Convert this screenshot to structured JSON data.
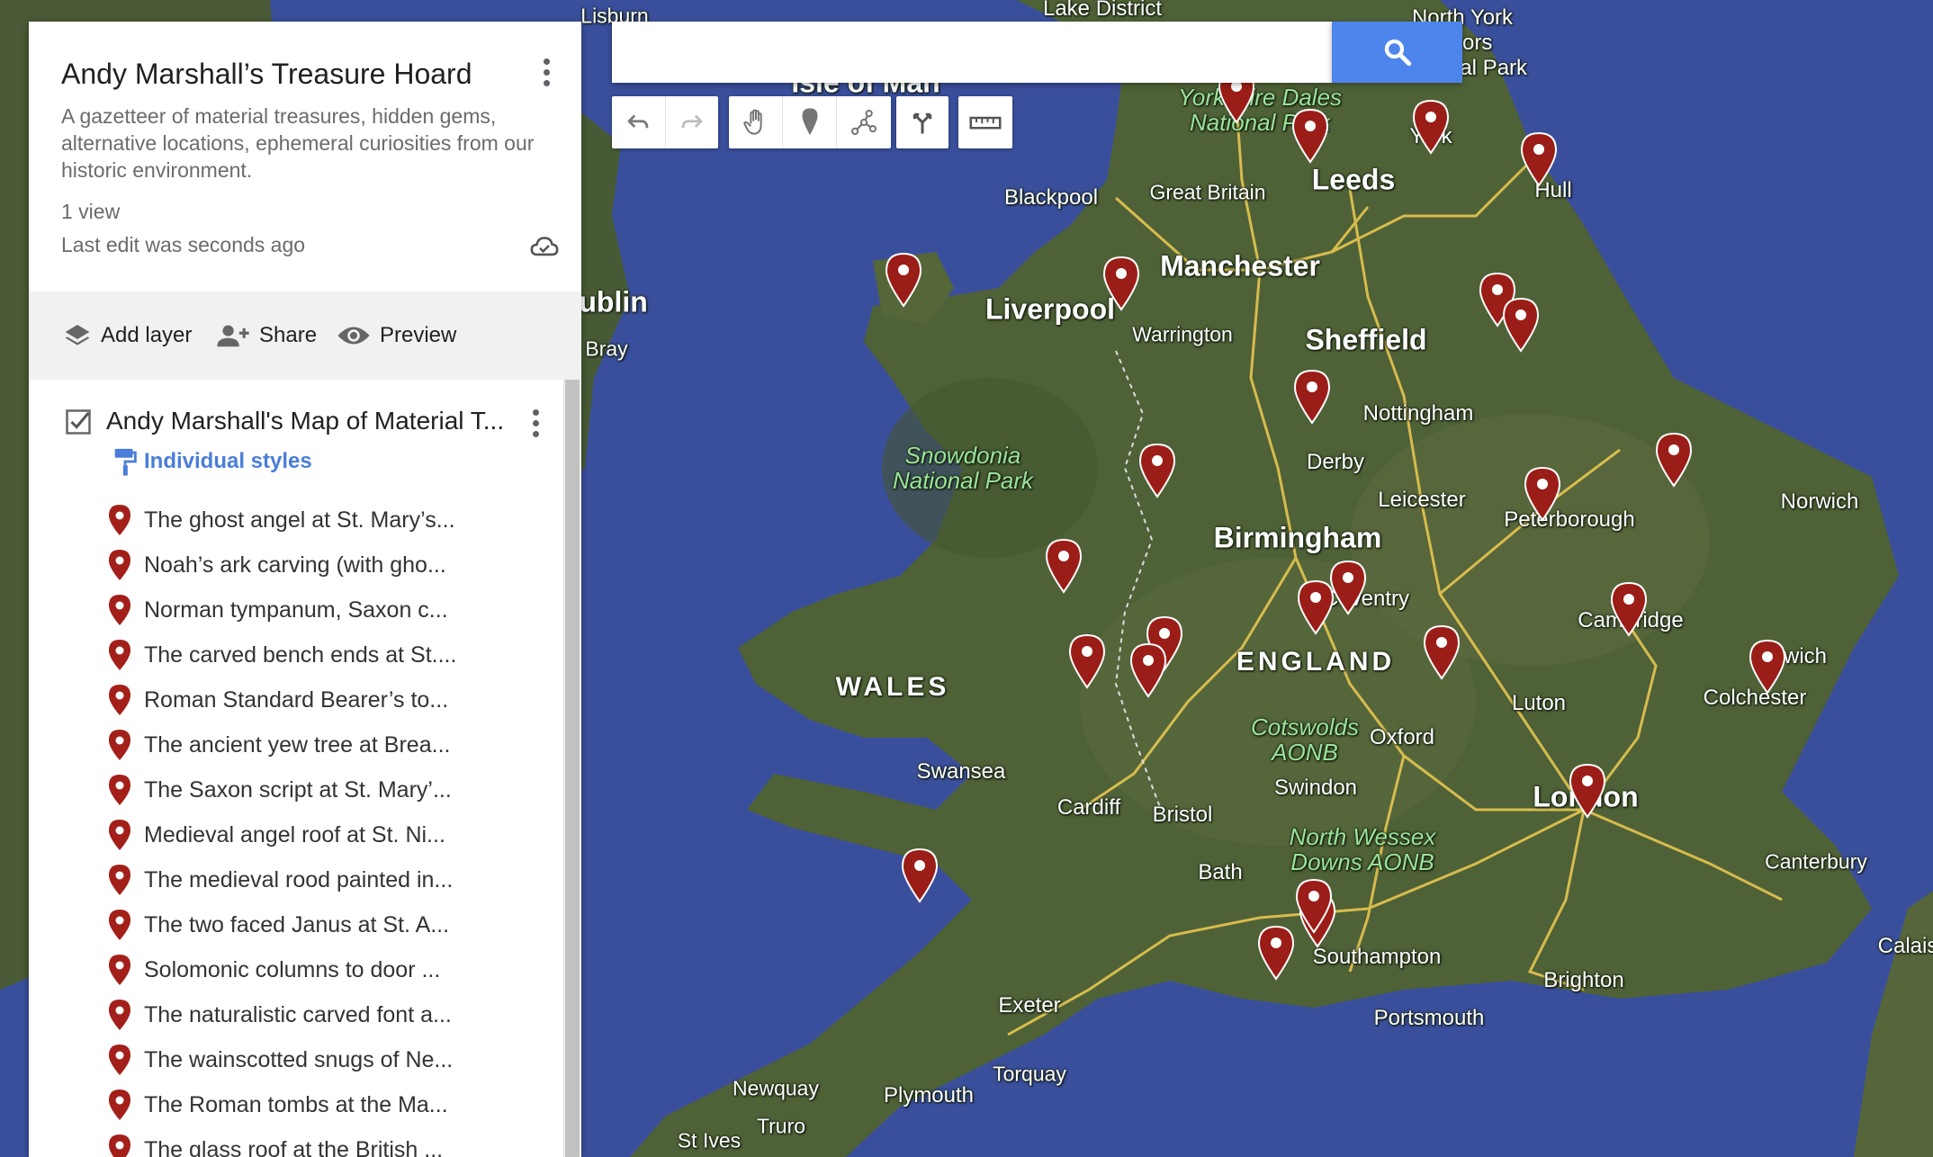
{
  "colors": {
    "sea": "#3a4f9c",
    "land": "#4f6137",
    "road": "#e6c650",
    "pin": "#9b1d17",
    "accent": "#4d85ec"
  },
  "panel": {
    "title": "Andy Marshall’s Treasure Hoard",
    "description": "A gazetteer of material treasures, hidden gems, alternative locations, ephemeral curiosities from our historic environment.",
    "views": "1 view",
    "last_edit": "Last edit was seconds ago",
    "actions": {
      "add_layer": "Add layer",
      "share": "Share",
      "preview": "Preview"
    }
  },
  "layer": {
    "name": "Andy Marshall's Map of Material T...",
    "checked": true,
    "style_label": "Individual styles",
    "features": [
      "The ghost angel at St. Mary’s...",
      "Noah’s ark carving (with gho...",
      "Norman tympanum, Saxon c...",
      "The carved bench ends at St....",
      "Roman Standard Bearer’s to...",
      "The ancient yew tree at Brea...",
      "The  Saxon script at St. Mary’...",
      "Medieval angel roof at St. Ni...",
      "The medieval rood painted in...",
      "The two faced Janus at St. A...",
      "Solomonic columns to door ...",
      "The naturalistic carved font a...",
      "The wainscotted snugs of Ne...",
      "The Roman tombs at the Ma...",
      "The glass roof at the British ..."
    ]
  },
  "search": {
    "value": "",
    "placeholder": ""
  },
  "toolbar": [
    "undo-icon",
    "redo-icon",
    "hand-icon",
    "marker-icon",
    "draw-line-icon",
    "directions-icon",
    "ruler-icon"
  ],
  "map_labels": {
    "lisburn": "Lisburn",
    "lake_district": "Lake District",
    "north_york_moors": "North York\nMoors\nNational Park",
    "isle_of_man": "Isle of Man",
    "dales": "Yorkshire Dales\nNational Park",
    "leeds": "Leeds",
    "york": "York",
    "hull": "Hull",
    "blackpool": "Blackpool",
    "great_britain": "Great Britain",
    "manchester": "Manchester",
    "liverpool": "Liverpool",
    "warrington": "Warrington",
    "sheffield": "Sheffield",
    "dublin": "Dublin",
    "bray": "Bray",
    "nottingham": "Nottingham",
    "derby": "Derby",
    "snowdonia": "Snowdonia\nNational Park",
    "leicester": "Leicester",
    "peterborough": "Peterborough",
    "norwich": "Norwich",
    "birmingham": "Birmingham",
    "coventry": "Coventry",
    "cambridge": "Cambridge",
    "england": "ENGLAND",
    "wales": "WALES",
    "ipswich": "Ipswich",
    "colchester": "Colchester",
    "luton": "Luton",
    "cotswolds": "Cotswolds\nAONB",
    "oxford": "Oxford",
    "swansea": "Swansea",
    "swindon": "Swindon",
    "london": "London",
    "cardiff": "Cardiff",
    "bristol": "Bristol",
    "north_wessex": "North Wessex\nDowns AONB",
    "bath": "Bath",
    "canterbury": "Canterbury",
    "southampton": "Southampton",
    "calais": "Calais",
    "exeter": "Exeter",
    "brighton": "Brighton",
    "portsmouth": "Portsmouth",
    "torquay": "Torquay",
    "newquay": "Newquay",
    "plymouth": "Plymouth",
    "truro": "Truro",
    "st_ives": "St Ives"
  }
}
